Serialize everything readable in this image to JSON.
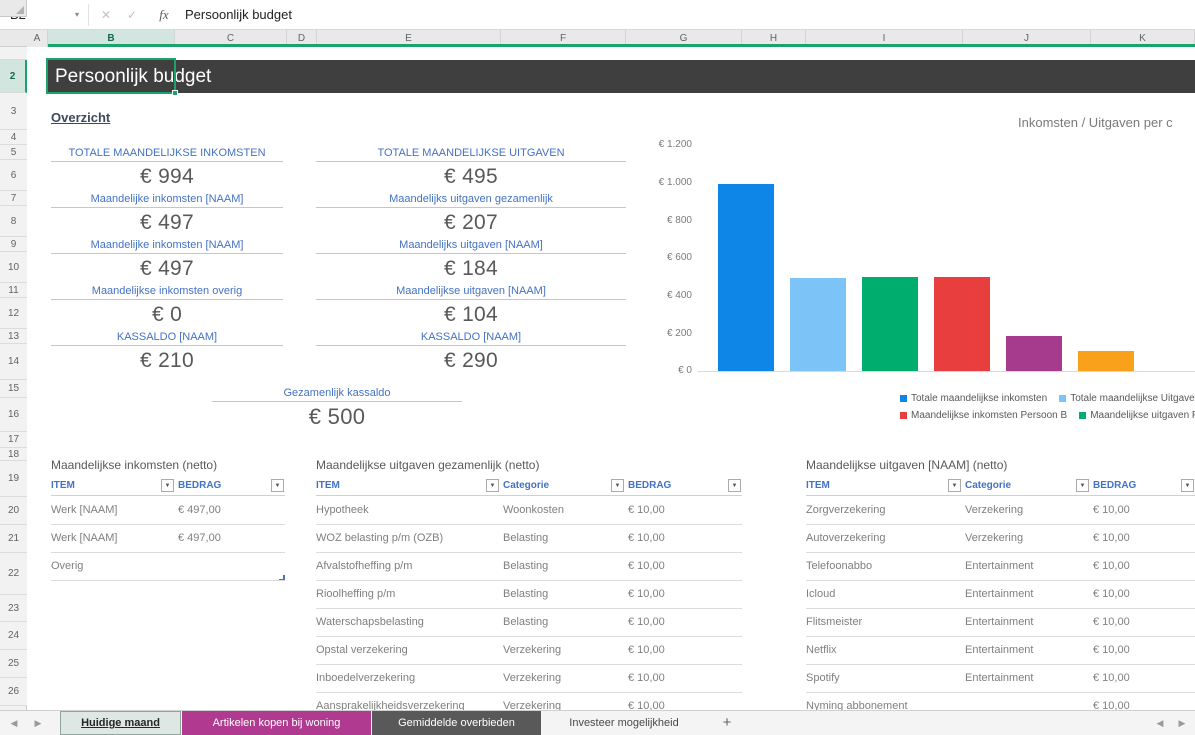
{
  "formula_bar": {
    "cell_ref": "B2",
    "formula": "Persoonlijk budget",
    "fx_label": "fx"
  },
  "icons": {
    "dropdown": "▾",
    "cancel": "✕",
    "confirm": "✓",
    "filter": "▼",
    "nav_left": "◀",
    "nav_right": "▶",
    "add": "+"
  },
  "grid": {
    "columns": [
      "A",
      "B",
      "C",
      "D",
      "E",
      "F",
      "G",
      "H",
      "I",
      "J",
      "K"
    ],
    "rows": [
      "2",
      "3",
      "4",
      "5",
      "6",
      "7",
      "8",
      "9",
      "10",
      "11",
      "12",
      "13",
      "14",
      "15",
      "16",
      "17",
      "18",
      "19",
      "20",
      "21",
      "22",
      "23",
      "24",
      "25",
      "26"
    ],
    "selected_column": "B",
    "selected_row": "2"
  },
  "sheet": {
    "title": "Persoonlijk budget",
    "overview_heading": "Overzicht"
  },
  "overview": {
    "income": {
      "items": [
        {
          "label": "TOTALE MAANDELIJKSE INKOMSTEN",
          "value": "€ 994"
        },
        {
          "label": "Maandelijke inkomsten [NAAM]",
          "value": "€ 497"
        },
        {
          "label": "Maandelijke inkomsten [NAAM]",
          "value": "€ 497"
        },
        {
          "label": "Maandelijkse inkomsten overig",
          "value": "€ 0"
        },
        {
          "label": "KASSALDO [NAAM]",
          "value": "€ 210"
        }
      ]
    },
    "expenses": {
      "items": [
        {
          "label": "TOTALE MAANDELIJKSE UITGAVEN",
          "value": "€ 495"
        },
        {
          "label": "Maandelijks uitgaven gezamenlijk",
          "value": "€ 207"
        },
        {
          "label": "Maandelijks uitgaven [NAAM]",
          "value": "€ 184"
        },
        {
          "label": "Maandelijkse uitgaven [NAAM]",
          "value": "€ 104"
        },
        {
          "label": "KASSALDO [NAAM]",
          "value": "€ 290"
        }
      ]
    },
    "joint": {
      "label": "Gezamenlijk kassaldo",
      "value": "€ 500"
    }
  },
  "chart_data": {
    "type": "bar",
    "title": "Inkomsten / Uitgaven per c",
    "ylim": [
      0,
      1200
    ],
    "y_ticks": [
      "€ 1.200",
      "€ 1.000",
      "€ 800",
      "€ 600",
      "€ 400",
      "€ 200",
      "€ 0"
    ],
    "grid": false,
    "legend_position": "bottom-right",
    "bars": [
      {
        "value": 994,
        "color": "#0d86e8"
      },
      {
        "value": 495,
        "color": "#7cc3f7"
      },
      {
        "value": 497,
        "color": "#00ac6e"
      },
      {
        "value": 497,
        "color": "#e93e3e"
      },
      {
        "value": 184,
        "color": "#a63a8c"
      },
      {
        "value": 104,
        "color": "#f9a11b"
      }
    ],
    "legend": [
      {
        "label": "Totale maandelijkse inkomsten",
        "color": "#0d86e8"
      },
      {
        "label": "Totale maandelijkse Uitgaven",
        "color": "#7cc3f7"
      },
      {
        "label": "Maandelijkse inkomsten Persoon B",
        "color": "#e93e3e"
      },
      {
        "label": "Maandelijkse uitgaven Persoon",
        "color": "#00ac6e"
      }
    ]
  },
  "tables": [
    {
      "title": "Maandelijkse inkomsten (netto)",
      "columns": [
        "ITEM",
        "BEDRAG"
      ],
      "rows": [
        [
          "Werk [NAAM]",
          "€ 497,00"
        ],
        [
          "Werk [NAAM]",
          "€ 497,00"
        ],
        [
          "Overig",
          ""
        ]
      ]
    },
    {
      "title": "Maandelijkse uitgaven gezamenlijk (netto)",
      "columns": [
        "ITEM",
        "Categorie",
        "BEDRAG"
      ],
      "rows": [
        [
          "Hypotheek",
          "Woonkosten",
          "€ 10,00"
        ],
        [
          "WOZ belasting p/m (OZB)",
          "Belasting",
          "€ 10,00"
        ],
        [
          "Afvalstofheffing p/m",
          "Belasting",
          "€ 10,00"
        ],
        [
          "Rioolheffing p/m",
          "Belasting",
          "€ 10,00"
        ],
        [
          "Waterschapsbelasting",
          "Belasting",
          "€ 10,00"
        ],
        [
          "Opstal verzekering",
          "Verzekering",
          "€ 10,00"
        ],
        [
          "Inboedelverzekering",
          "Verzekering",
          "€ 10,00"
        ],
        [
          "Aansprakelijkheidsverzekering",
          "Verzekering",
          "€ 10,00"
        ]
      ]
    },
    {
      "title": "Maandelijkse uitgaven [NAAM] (netto)",
      "columns": [
        "ITEM",
        "Categorie",
        "BEDRAG"
      ],
      "rows": [
        [
          "Zorgverzekering",
          "Verzekering",
          "€ 10,00"
        ],
        [
          "Autoverzekering",
          "Verzekering",
          "€ 10,00"
        ],
        [
          "Telefoonabbo",
          "Entertainment",
          "€ 10,00"
        ],
        [
          "Icloud",
          "Entertainment",
          "€ 10,00"
        ],
        [
          "Flitsmeister",
          "Entertainment",
          "€ 10,00"
        ],
        [
          "Netflix",
          "Entertainment",
          "€ 10,00"
        ],
        [
          "Spotify",
          "Entertainment",
          "€ 10,00"
        ],
        [
          "Nyming abbonement",
          "",
          "€ 10,00"
        ]
      ]
    }
  ],
  "sheet_tabs": {
    "tabs": [
      {
        "label": "Huidige maand",
        "bg": "#dfe7e4",
        "color": "#262626",
        "active": true
      },
      {
        "label": "Artikelen kopen bij woning",
        "bg": "#b03a90",
        "color": "#ffffff",
        "active": false
      },
      {
        "label": "Gemiddelde overbieden",
        "bg": "#595959",
        "color": "#ffffff",
        "active": false
      },
      {
        "label": "Investeer mogelijkheid",
        "bg": "",
        "color": "#4a4a4a",
        "active": false
      }
    ],
    "add_label": "+"
  },
  "colors": {
    "accent_green": "#1aa36b",
    "label_blue": "#4472c4",
    "title_bar": "#3f3f3f",
    "value_gray": "#595959"
  }
}
